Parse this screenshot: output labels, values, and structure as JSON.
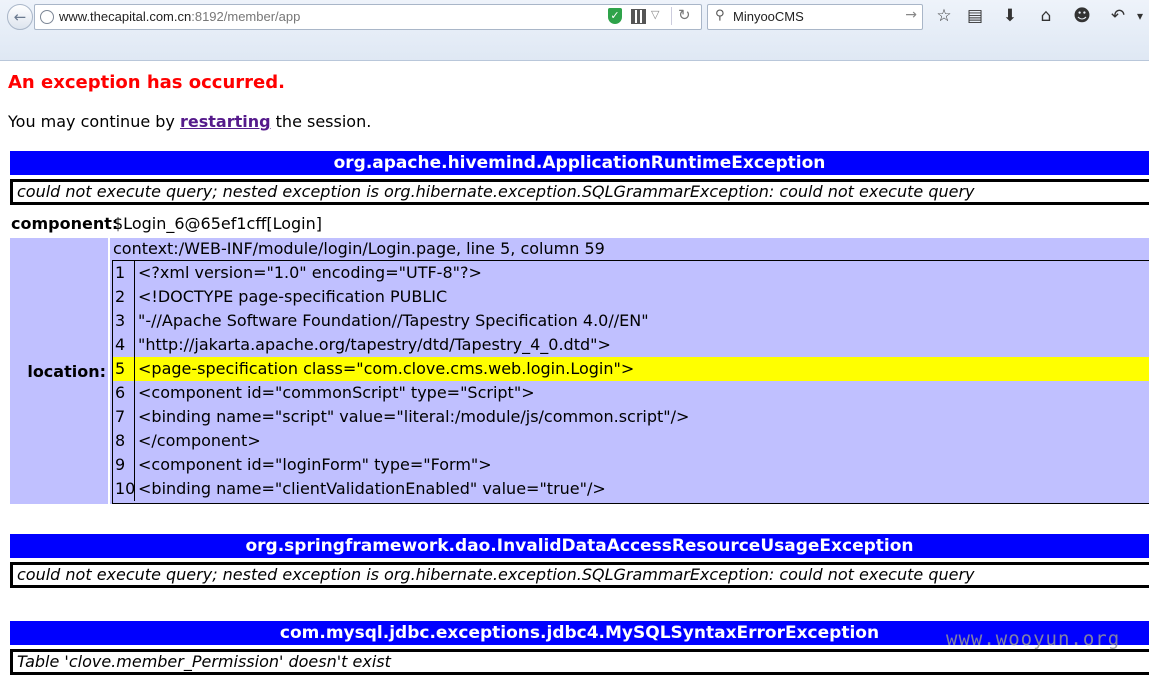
{
  "browser": {
    "url_host": "www.thecapital.com.cn",
    "url_rest": ":8192/member/app",
    "search_value": "MinyooCMS",
    "icons": [
      "back-icon",
      "globe-icon",
      "shield-icon",
      "qr-code-icon",
      "dropdown-icon",
      "reload-icon",
      "search-icon",
      "go-icon",
      "bookmark-star-icon",
      "bookmarks-list-icon",
      "download-icon",
      "home-icon",
      "smiley-icon",
      "undo-icon"
    ]
  },
  "page": {
    "error_title": "An exception has occurred.",
    "continue_prefix": "You may continue by",
    "restart_link": "restarting",
    "continue_suffix": "the session.",
    "exceptions": [
      {
        "name": "org.apache.hivemind.ApplicationRuntimeException",
        "message": "could not execute query; nested exception is org.hibernate.exception.SQLGrammarException: could not execute query",
        "component_label": "component:",
        "component_value": "$Login_6@65ef1cff[Login]",
        "location_label": "location:",
        "location_path": "context:/WEB-INF/module/login/Login.page, line 5, column 59",
        "code_lines": [
          {
            "n": "1",
            "text": "<?xml version=\"1.0\" encoding=\"UTF-8\"?>"
          },
          {
            "n": "2",
            "text": "<!DOCTYPE page-specification PUBLIC"
          },
          {
            "n": "3",
            "text": "\"-//Apache Software Foundation//Tapestry Specification 4.0//EN\""
          },
          {
            "n": "4",
            "text": "\"http://jakarta.apache.org/tapestry/dtd/Tapestry_4_0.dtd\">"
          },
          {
            "n": "5",
            "text": "<page-specification class=\"com.clove.cms.web.login.Login\">"
          },
          {
            "n": "6",
            "text": "<component id=\"commonScript\" type=\"Script\">"
          },
          {
            "n": "7",
            "text": "<binding name=\"script\" value=\"literal:/module/js/common.script\"/>"
          },
          {
            "n": "8",
            "text": "</component>"
          },
          {
            "n": "9",
            "text": "<component id=\"loginForm\" type=\"Form\">"
          },
          {
            "n": "10",
            "text": "<binding name=\"clientValidationEnabled\" value=\"true\"/>"
          }
        ],
        "highlight_line": "5"
      },
      {
        "name": "org.springframework.dao.InvalidDataAccessResourceUsageException",
        "message": "could not execute query; nested exception is org.hibernate.exception.SQLGrammarException: could not execute query"
      },
      {
        "name": "com.mysql.jdbc.exceptions.jdbc4.MySQLSyntaxErrorException",
        "message": "Table 'clove.member_Permission' doesn't exist"
      }
    ],
    "watermark": "www.wooyun.org"
  },
  "colors": {
    "error_red": "#ff0000",
    "header_blue": "#0000ff",
    "location_bg": "#c0c0ff",
    "highlight_yellow": "#ffff00",
    "link_purple": "#551a8b"
  }
}
